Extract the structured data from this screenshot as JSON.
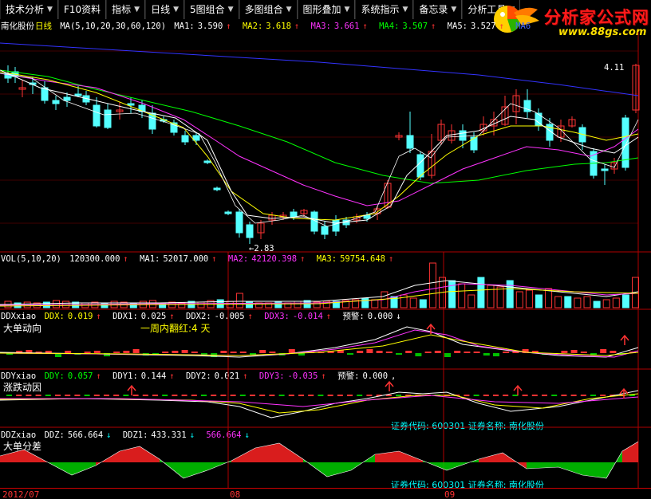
{
  "toolbar": [
    {
      "label": "技术分析",
      "dropdown": true
    },
    {
      "label": "F10资料",
      "dropdown": false
    },
    {
      "label": "指标",
      "dropdown": true
    },
    {
      "label": "日线",
      "dropdown": true
    },
    {
      "label": "5图组合",
      "dropdown": true
    },
    {
      "label": "多图组合",
      "dropdown": true
    },
    {
      "label": "图形叠加",
      "dropdown": true
    },
    {
      "label": "系统指示",
      "dropdown": true
    },
    {
      "label": "备忘录",
      "dropdown": true
    },
    {
      "label": "分析工具",
      "dropdown": true
    }
  ],
  "logo": {
    "name": "分析家公式网",
    "url": "www.88gs.com"
  },
  "main_panel": {
    "stock": "南化股份",
    "period": "日线",
    "ma_params": "MA(5,10,20,30,60,120)",
    "ma": [
      {
        "label": "MA1:",
        "value": "3.590",
        "arrow": "↑"
      },
      {
        "label": "MA2:",
        "value": "3.618",
        "arrow": "↑"
      },
      {
        "label": "MA3:",
        "value": "3.661",
        "arrow": "↑"
      },
      {
        "label": "MA4:",
        "value": "3.507",
        "arrow": "↑"
      },
      {
        "label": "MA5:",
        "value": "3.527",
        "arrow": "↑"
      },
      {
        "label": "MA6",
        "value": "",
        "arrow": ""
      }
    ],
    "high_label": "4.11",
    "low_label": "2.83"
  },
  "vol_panel": {
    "label": "VOL(5,10,20)",
    "vol": {
      "value": "120300.000",
      "arrow": "↑"
    },
    "ma": [
      {
        "label": "MA1:",
        "value": "52017.000",
        "arrow": "↑"
      },
      {
        "label": "MA2:",
        "value": "42120.398",
        "arrow": "↑"
      },
      {
        "label": "MA3:",
        "value": "59754.648",
        "arrow": "↑"
      }
    ]
  },
  "ddx_panel": {
    "name": "DDXxiao",
    "items": [
      {
        "label": "DDX:",
        "value": "0.019",
        "arrow": "↑"
      },
      {
        "label": "DDX1:",
        "value": "0.025",
        "arrow": "↑"
      },
      {
        "label": "DDX2:",
        "value": "-0.005",
        "arrow": "↑"
      },
      {
        "label": "DDX3:",
        "value": "-0.014",
        "arrow": "↑"
      },
      {
        "label": "预警:",
        "value": "0.000",
        "arrow": "↓"
      }
    ],
    "title": "大单动向",
    "note": "一周内翻红:4 天"
  },
  "ddy_panel": {
    "name": "DDYxiao",
    "items": [
      {
        "label": "DDY:",
        "value": "0.057",
        "arrow": "↑"
      },
      {
        "label": "DDY1:",
        "value": "0.144",
        "arrow": "↑"
      },
      {
        "label": "DDY2:",
        "value": "0.021",
        "arrow": "↑"
      },
      {
        "label": "DDY3:",
        "value": "-0.035",
        "arrow": "↑"
      },
      {
        "label": "预警:",
        "value": "0.000",
        "arrow": ","
      }
    ],
    "title": "涨跌动因",
    "stock_info": "证券代码: 600301  证券名称: 南化股份"
  },
  "ddz_panel": {
    "name": "DDZxiao",
    "items": [
      {
        "label": "DDZ:",
        "value": "566.664",
        "arrow": "↓"
      },
      {
        "label": "DDZ1:",
        "value": "433.331",
        "arrow": "↓"
      },
      {
        "label": "",
        "value": "566.664",
        "arrow": "↓"
      }
    ],
    "title": "大单分差",
    "stock_info": "证券代码: 600301  证券名称: 南化股份"
  },
  "dates": [
    "2012/07",
    "08",
    "09"
  ],
  "colors": {
    "up": "#ff3333",
    "down": "#54ffff",
    "ma1": "#ffffff",
    "ma2": "#ffff00",
    "ma3": "#ff33ff",
    "ma4": "#00ff00",
    "ma5": "#ffffff",
    "ma6": "#3333ff"
  }
}
